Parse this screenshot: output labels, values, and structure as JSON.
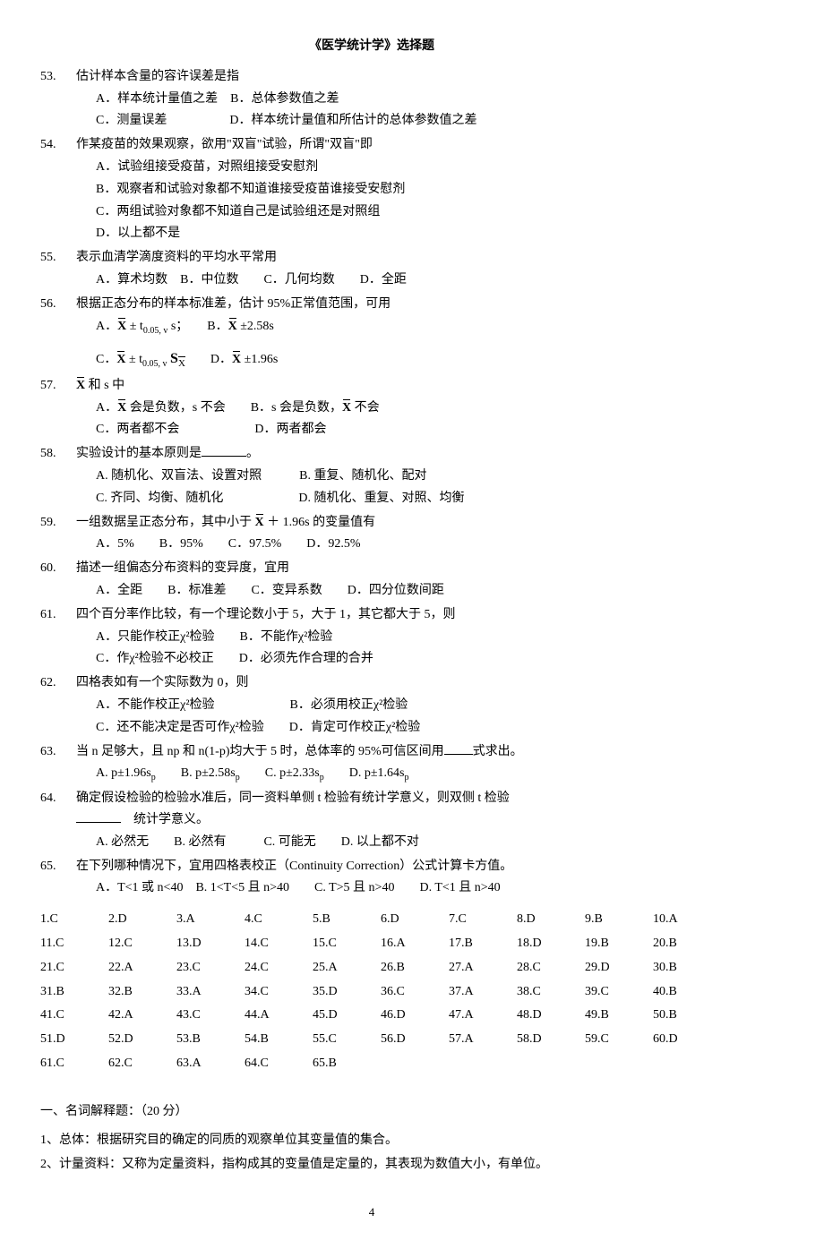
{
  "header_title": "《医学统计学》选择题",
  "questions": [
    {
      "num": "53.",
      "text": "估计样本含量的容许误差是指",
      "opts": [
        "A．样本统计量值之差　B．总体参数值之差",
        "C．测量误差　　　　　D．样本统计量值和所估计的总体参数值之差"
      ]
    },
    {
      "num": "54.",
      "text": "作某疫苗的效果观察，欲用\"双盲\"试验，所谓\"双盲\"即",
      "opts": [
        "A．试验组接受疫苗，对照组接受安慰剂",
        "B．观察者和试验对象都不知道谁接受疫苗谁接受安慰剂",
        "C．两组试验对象都不知道自己是试验组还是对照组",
        "D．以上都不是"
      ]
    },
    {
      "num": "55.",
      "text": "表示血清学滴度资料的平均水平常用",
      "opts": [
        "A．算术均数　B．中位数　　C．几何均数　　D．全距"
      ]
    },
    {
      "num": "56.",
      "text": "根据正态分布的样本标准差，估计 95%正常值范围，可用",
      "opts": [
        "A．X̄ ± t₀.₀₅,ᵥ s；　　B．X̄ ±2.58s",
        "",
        "C．X̄ ± t₀.₀₅,ᵥ S_X̄　　D．X̄ ±1.96s"
      ],
      "special": "q56"
    },
    {
      "num": "57.",
      "text": "X̄ 和 s 中",
      "special": "q57",
      "opts": [
        "A．X̄ 会是负数，s 不会　　B．s 会是负数，X̄ 不会",
        "C．两者都不会　　　　　　D．两者都会"
      ]
    },
    {
      "num": "58.",
      "text": "实验设计的基本原则是________。",
      "special": "q58",
      "opts": [
        "A. 随机化、双盲法、设置对照　　　B. 重复、随机化、配对",
        "C. 齐同、均衡、随机化　　　　　　D. 随机化、重复、对照、均衡"
      ]
    },
    {
      "num": "59.",
      "text": "一组数据呈正态分布，其中小于 X̄ ＋ 1.96s 的变量值有",
      "special": "q59",
      "opts": [
        "A．5%　　B．95%　　C．97.5%　　D．92.5%"
      ]
    },
    {
      "num": "60.",
      "text": "描述一组偏态分布资料的变异度，宜用",
      "opts": [
        "A．全距　　B．标准差　　C．变异系数　　D．四分位数间距"
      ]
    },
    {
      "num": "61.",
      "text": "四个百分率作比较，有一个理论数小于 5，大于 1，其它都大于 5，则",
      "opts": [
        "A．只能作校正χ²检验　　B．不能作χ²检验",
        "C．作χ²检验不必校正　　D．必须先作合理的合并"
      ]
    },
    {
      "num": "62.",
      "text": "四格表如有一个实际数为 0，则",
      "opts": [
        "A．不能作校正χ²检验　　　　　　B．必须用校正χ²检验",
        "C．还不能决定是否可作χ²检验　　D．肯定可作校正χ²检验"
      ]
    },
    {
      "num": "63.",
      "text": "当 n 足够大，且 np 和 n(1-p)均大于 5 时，总体率的 95%可信区间用____式求出。",
      "special": "q63",
      "opts": [
        "A. p±1.96sₚ　　B. p±2.58sₚ　　C. p±2.33sₚ　　D. p±1.64sₚ"
      ]
    },
    {
      "num": "64.",
      "text": "确定假设检验的检验水准后，同一资料单侧 t 检验有统计学意义，则双侧 t 检验",
      "text2": "______　统计学意义。",
      "special": "q64",
      "opts": [
        "A. 必然无　　B. 必然有　　　C. 可能无　　D. 以上都不对"
      ]
    },
    {
      "num": "65.",
      "text": "在下列哪种情况下，宜用四格表校正（Continuity Correction）公式计算卡方值。",
      "opts": [
        "A．T<1 或 n<40　B. 1<T<5 且 n>40　　C. T>5 且 n>40　　D. T<1 且 n>40"
      ]
    }
  ],
  "answers": [
    [
      "1.C",
      "2.D",
      "3.A",
      "4.C",
      "5.B",
      "6.D",
      "7.C",
      "8.D",
      "9.B",
      "10.A"
    ],
    [
      "11.C",
      "12.C",
      "13.D",
      "14.C",
      "15.C",
      "16.A",
      "17.B",
      "18.D",
      "19.B",
      "20.B"
    ],
    [
      "21.C",
      "22.A",
      "23.C",
      "24.C",
      "25.A",
      "26.B",
      "27.A",
      "28.C",
      "29.D",
      "30.B"
    ],
    [
      "31.B",
      "32.B",
      "33.A",
      "34.C",
      "35.D",
      "36.C",
      "37.A",
      "38.C",
      "39.C",
      "40.B"
    ],
    [
      "41.C",
      "42.A",
      "43.C",
      "44.A",
      "45.D",
      "46.D",
      "47.A",
      "48.D",
      "49.B",
      "50.B"
    ],
    [
      "51.D",
      "52.D",
      "53.B",
      "54.B",
      "55.C",
      "56.D",
      "57.A",
      "58.D",
      "59.C",
      "60.D"
    ],
    [
      "61.C",
      "62.C",
      "63.A",
      "64.C",
      "65.B"
    ]
  ],
  "section_title": "一、名词解释题：（20 分）",
  "definitions": [
    "1、总体：根据研究目的确定的同质的观察单位其变量值的集合。",
    "2、计量资料：又称为定量资料，指构成其的变量值是定量的，其表现为数值大小，有单位。"
  ],
  "page_number": "4"
}
